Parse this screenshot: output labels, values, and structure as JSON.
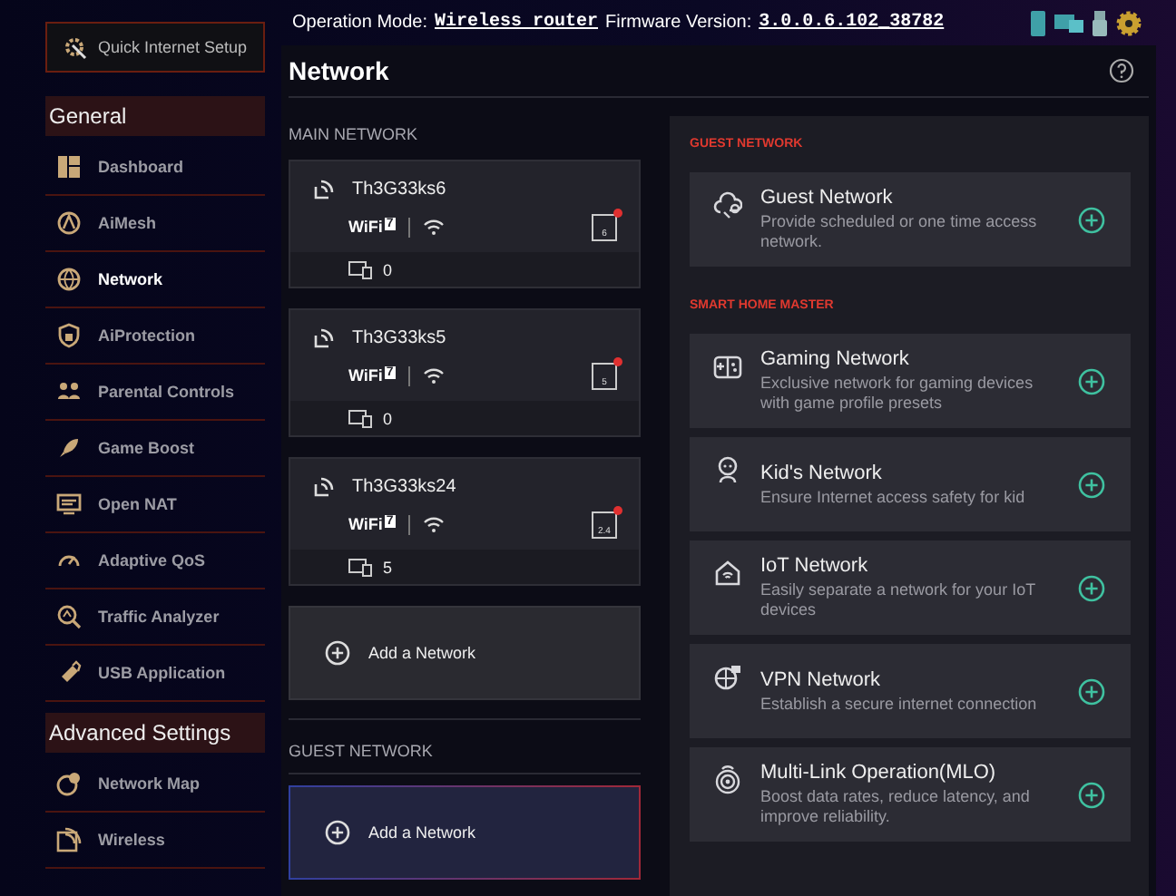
{
  "top_bar": {
    "operation_mode_label": "Operation Mode:",
    "operation_mode": "Wireless router",
    "firmware_label": "Firmware Version:",
    "firmware_version": "3.0.0.6.102_38782"
  },
  "sidebar": {
    "quick_setup": "Quick Internet Setup",
    "sections": [
      {
        "title": "General",
        "items": [
          {
            "label": "Dashboard",
            "selected": false
          },
          {
            "label": "AiMesh",
            "selected": false
          },
          {
            "label": "Network",
            "selected": true
          },
          {
            "label": "AiProtection",
            "selected": false
          },
          {
            "label": "Parental Controls",
            "selected": false
          },
          {
            "label": "Game Boost",
            "selected": false
          },
          {
            "label": "Open NAT",
            "selected": false
          },
          {
            "label": "Adaptive QoS",
            "selected": false
          },
          {
            "label": "Traffic Analyzer",
            "selected": false
          },
          {
            "label": "USB Application",
            "selected": false
          }
        ]
      },
      {
        "title": "Advanced Settings",
        "items": [
          {
            "label": "Network Map",
            "selected": false
          },
          {
            "label": "Wireless",
            "selected": false
          }
        ]
      }
    ]
  },
  "page": {
    "title": "Network",
    "main_network": {
      "heading": "MAIN NETWORK",
      "networks": [
        {
          "name": "Th3G33ks6",
          "wifi_logo": "WiFi",
          "wifi_generation": "7",
          "band": "6",
          "clients": "0"
        },
        {
          "name": "Th3G33ks5",
          "wifi_logo": "WiFi",
          "wifi_generation": "7",
          "band": "5",
          "clients": "0"
        },
        {
          "name": "Th3G33ks24",
          "wifi_logo": "WiFi",
          "wifi_generation": "7",
          "band": "2.4",
          "clients": "5"
        }
      ],
      "add_label": "Add a Network"
    },
    "guest_network": {
      "heading": "GUEST NETWORK",
      "add_label": "Add a Network"
    }
  },
  "features": [
    {
      "heading": "GUEST NETWORK",
      "cards": [
        {
          "kind": "guest",
          "title": "Guest Network",
          "description": "Provide scheduled or one time access network."
        }
      ]
    },
    {
      "heading": "SMART HOME MASTER",
      "cards": [
        {
          "kind": "gaming",
          "title": "Gaming Network",
          "description": "Exclusive network for gaming devices with game profile presets"
        },
        {
          "kind": "kid",
          "title": "Kid's Network",
          "description": "Ensure Internet access safety for kid"
        },
        {
          "kind": "iot",
          "title": "IoT Network",
          "description": "Easily separate a network for your IoT devices"
        },
        {
          "kind": "vpn",
          "title": "VPN Network",
          "description": "Establish a secure internet connection"
        },
        {
          "kind": "mlo",
          "title": "Multi-Link Operation(MLO)",
          "description": "Boost data rates, reduce latency, and improve reliability."
        }
      ]
    }
  ]
}
